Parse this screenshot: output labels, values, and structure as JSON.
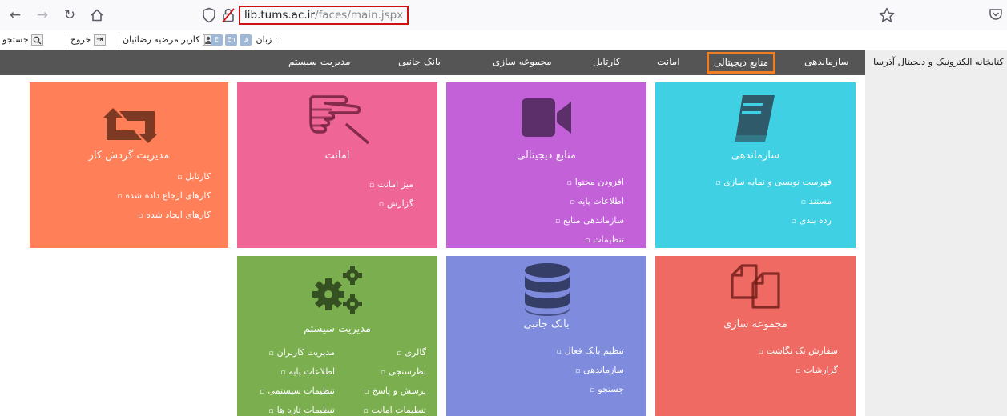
{
  "browser": {
    "back_icon": "back-arrow-icon",
    "forward_icon": "forward-arrow-icon",
    "reload_icon": "reload-icon",
    "home_icon": "home-icon",
    "url_host": "lib.tums.ac.ir",
    "url_path": "/faces/main.jspx"
  },
  "toolbar": {
    "search_label": "جستجو",
    "logout_label": "خروج",
    "user_label": "کاربر مرضیه رضائیان",
    "language_label": "زبان :",
    "lang_options": [
      "E",
      "En",
      "فا"
    ]
  },
  "nav": {
    "brand": "کتابخانه الکترونیک و دیجیتال آذرسا",
    "items": [
      "سازماندهی",
      "منابع دیجیتالی",
      "امانت",
      "کارتابل",
      "مجموعه سازی",
      "بانک جانبی",
      "مدیریت سیستم"
    ],
    "active_index": 1
  },
  "colors": {
    "nav_bg": "#555555",
    "active_outline": "#f07f24",
    "url_outline": "#d01010",
    "tile_organization": "#3fd1e3",
    "tile_digital": "#c261d8",
    "tile_loan": "#ee6596",
    "tile_workflow": "#ff7f58",
    "tile_collection": "#ef6a63",
    "tile_databank": "#7f8bdc",
    "tile_system": "#7aae4e"
  },
  "tiles": {
    "organization": {
      "title": "سازماندهی",
      "icon": "book-icon",
      "links": [
        "فهرست نویسی و نمایه سازی",
        "مستند",
        "رده بندی"
      ]
    },
    "digital": {
      "title": "منابع دیجیتالی",
      "icon": "video-camera-icon",
      "links": [
        "افزودن محتوا",
        "اطلاعات پایه",
        "سازماندهی منابع",
        "تنظیمات"
      ]
    },
    "loan": {
      "title": "امانت",
      "icon": "hand-icon",
      "links": [
        "میز امانت",
        "گزارش"
      ]
    },
    "workflow": {
      "title": "مدیریت گردش کار",
      "icon": "retweet-icon",
      "links": [
        "کارتابل",
        "کارهای ارجاع داده شده",
        "کارهای ایجاد شده"
      ]
    },
    "collection": {
      "title": "مجموعه سازی",
      "icon": "documents-icon",
      "links": [
        "سفارش تک نگاشت",
        "گزارشات"
      ]
    },
    "databank": {
      "title": "بانک جانبی",
      "icon": "database-icon",
      "links": [
        "تنظیم بانک فعال",
        "سازماندهی",
        "جستجو"
      ]
    },
    "system": {
      "title": "مدیریت سیستم",
      "icon": "gears-icon",
      "links_right": [
        "گالری",
        "نظرسنجی",
        "پرسش و پاسخ",
        "تنظیمات امانت"
      ],
      "links_left": [
        "مدیریت کاربران",
        "اطلاعات پایه",
        "تنظیمات سیستمی",
        "تنظیمات تازه ها"
      ]
    }
  }
}
